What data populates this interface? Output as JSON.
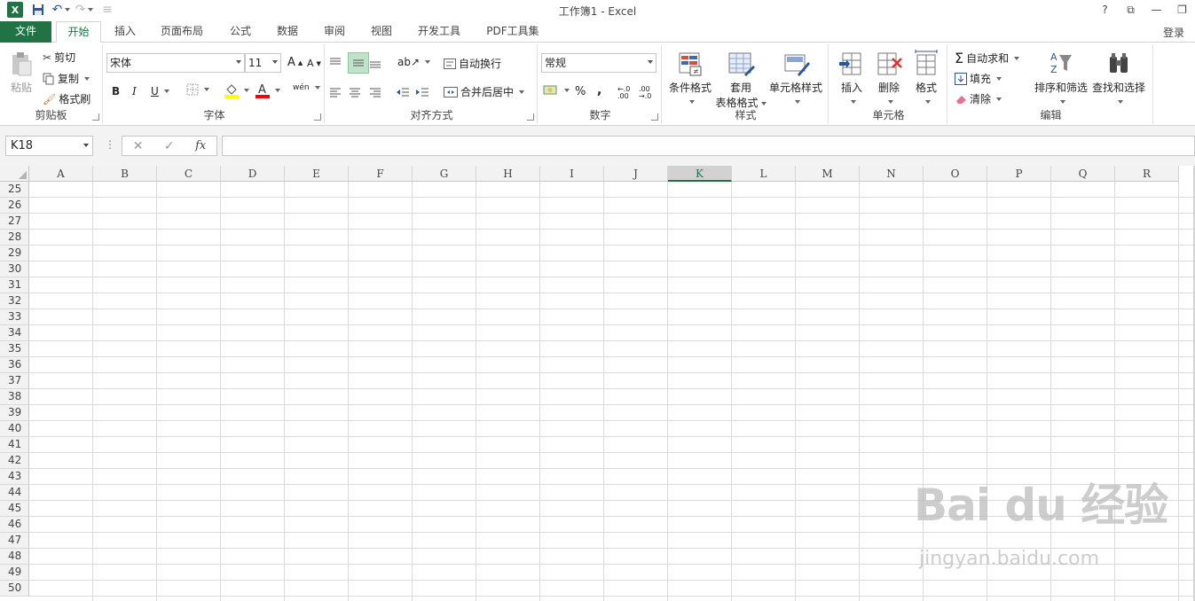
{
  "window": {
    "title": "工作簿1 - Excel"
  },
  "window_controls": {
    "help": "?",
    "ribbon_options": "⧉",
    "minimize": "—",
    "restore": "❐"
  },
  "tabs": [
    {
      "label": "文件"
    },
    {
      "label": "开始"
    },
    {
      "label": "插入"
    },
    {
      "label": "页面布局"
    },
    {
      "label": "公式"
    },
    {
      "label": "数据"
    },
    {
      "label": "审阅"
    },
    {
      "label": "视图"
    },
    {
      "label": "开发工具"
    },
    {
      "label": "PDF工具集"
    }
  ],
  "login": "登录",
  "clipboard": {
    "group": "剪贴板",
    "paste": "粘贴",
    "cut": "剪切",
    "copy": "复制",
    "format_painter": "格式刷"
  },
  "font": {
    "group": "字体",
    "name": "宋体",
    "size": "11",
    "bold": "B",
    "italic": "I",
    "underline": "U",
    "grow": "A",
    "shrink": "A",
    "phonetic": "wén"
  },
  "alignment": {
    "group": "对齐方式",
    "wrap": "自动换行",
    "merge": "合并后居中"
  },
  "number": {
    "group": "数字",
    "format": "常规",
    "percent": "%",
    "comma": ",",
    "inc_decimal": "←.0 .00",
    "dec_decimal": ".00 →.0"
  },
  "styles": {
    "group": "样式",
    "conditional": "条件格式",
    "table_1": "套用",
    "table_2": "表格格式",
    "cell_styles": "单元格样式"
  },
  "cells": {
    "group": "单元格",
    "insert": "插入",
    "delete": "删除",
    "format": "格式"
  },
  "editing": {
    "group": "编辑",
    "autosum": "自动求和",
    "fill": "填充",
    "clear": "清除",
    "sort": "排序和筛选",
    "find": "查找和选择"
  },
  "formula_bar": {
    "name_box": "K18",
    "cancel": "✕",
    "enter": "✓",
    "fx": "fx",
    "value": ""
  },
  "grid": {
    "columns": [
      "A",
      "B",
      "C",
      "D",
      "E",
      "F",
      "G",
      "H",
      "I",
      "J",
      "K",
      "L",
      "M",
      "N",
      "O",
      "P",
      "Q",
      "R"
    ],
    "selected_column": "K",
    "rows": [
      "25",
      "26",
      "27",
      "28",
      "29",
      "30",
      "31",
      "32",
      "33",
      "34",
      "35",
      "36",
      "37",
      "38",
      "39",
      "40",
      "41",
      "42",
      "43",
      "44",
      "45",
      "46",
      "47",
      "48",
      "49",
      "50"
    ]
  },
  "watermark": {
    "logo": "Bai du 经验",
    "url": "jingyan.baidu.com"
  }
}
